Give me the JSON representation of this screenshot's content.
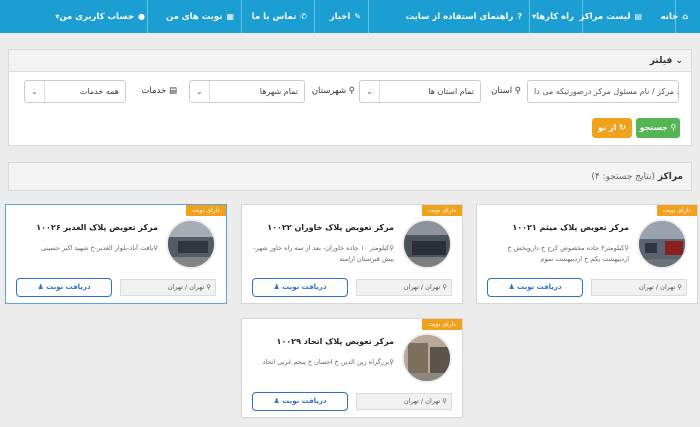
{
  "nav": {
    "home": "خانه",
    "centers": "لیست مراکز",
    "solutions": "راه کارها",
    "guide": "راهنمای استفاده از سایت",
    "news": "اخبار",
    "contact": "تماس با ما",
    "appointments": "نوبت های من",
    "account": "حساب کاربری من"
  },
  "filter": {
    "title": "فیلتر",
    "toggle_icon": "chevron-down",
    "search_placeholder": "کد مرکز / نام مسئول مرکز درصورتیکه می دا",
    "province_label": "استان",
    "province_value": "تمام استان ها",
    "city_label": "شهرستان",
    "city_value": "تمام شهرها",
    "service_label": "خدمات",
    "service_value": "همه خدمات",
    "search_button": "جستجو",
    "reset_button": "از نو"
  },
  "results": {
    "title": "مراکز",
    "count_text": "(نتایج جستجو: ۴)"
  },
  "colors": {
    "nav": "#1b9fd2",
    "badge": "#f0a21c",
    "search_btn": "#53b553",
    "reset_btn": "#f0a21c",
    "appt_border": "#2e6fc8"
  },
  "cards": [
    {
      "badge": "دارای نوبت",
      "title": "مرکز تعویض پلاک میثم ۱۰۰۲۱",
      "address": "کیلومتر۲ جاده مخصوص کرج خ داروپخش خ اردیبهشت پکم خ اردیبهشت سوم",
      "location": "تهران / تهران",
      "button": "دریافت نوبت"
    },
    {
      "badge": "دارای نوبت",
      "title": "مرکز تعویض پلاک خاوران ۱۰۰۲۲",
      "address": "کیلومتر ۱۰ جاده خاوران- بعد از سه راه خاور شهر- نبش قبرستان ارامنه",
      "location": "تهران / تهران",
      "button": "دریافت نوبت"
    },
    {
      "badge": "دارای نوبت",
      "title": "مرکز تعویض پلاک الغدیر ۱۰۰۲۶",
      "address": "یافت آباد-بلوار الغدیر-خ شهید اکبر حسینی",
      "location": "تهران / تهران",
      "button": "دریافت نوبت"
    },
    {
      "badge": "دارای نوبت",
      "title": "مرکز تعویض پلاک اتحاد ۱۰۰۲۹",
      "address": "بزرگراه زین الدین خ احسان خ پنجم غربی اتحاد",
      "location": "تهران / تهران",
      "button": "دریافت نوبت"
    }
  ]
}
